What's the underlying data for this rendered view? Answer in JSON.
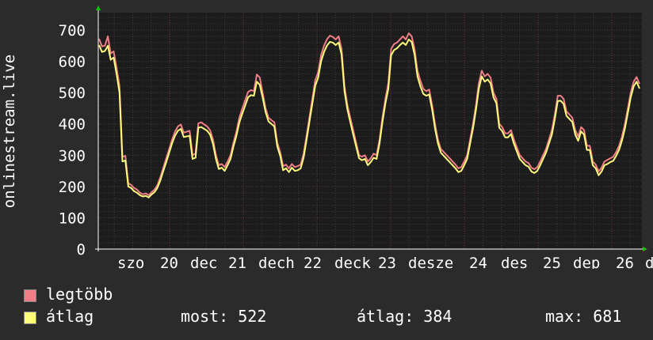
{
  "chart_data": {
    "type": "line",
    "ylabel": "onlinestream.live",
    "ylim": [
      0,
      700
    ],
    "yticks": [
      0,
      100,
      200,
      300,
      400,
      500,
      600,
      700
    ],
    "xticks": [
      "szo",
      "20",
      "dec",
      "21",
      "dech",
      "22",
      "deck",
      "23",
      "desze",
      "24",
      "des",
      "25",
      "dep",
      "26",
      "d"
    ],
    "grid": true,
    "series": [
      {
        "name": "legtöbb",
        "color": "#f07e86",
        "values": [
          672,
          648,
          650,
          680,
          625,
          632,
          580,
          520,
          295,
          298,
          210,
          205,
          195,
          190,
          180,
          175,
          178,
          172,
          182,
          190,
          205,
          230,
          260,
          290,
          320,
          350,
          375,
          392,
          398,
          372,
          375,
          378,
          300,
          305,
          402,
          405,
          398,
          392,
          380,
          350,
          300,
          268,
          272,
          262,
          280,
          300,
          340,
          375,
          420,
          448,
          475,
          502,
          508,
          505,
          558,
          548,
          500,
          450,
          420,
          412,
          405,
          340,
          310,
          265,
          270,
          258,
          272,
          262,
          265,
          270,
          305,
          360,
          420,
          480,
          540,
          565,
          620,
          650,
          670,
          682,
          678,
          670,
          680,
          640,
          520,
          460,
          420,
          380,
          340,
          300,
          295,
          300,
          280,
          290,
          305,
          300,
          350,
          420,
          480,
          530,
          640,
          655,
          660,
          670,
          680,
          670,
          690,
          680,
          640,
          570,
          538,
          512,
          505,
          510,
          460,
          400,
          350,
          320,
          310,
          300,
          290,
          280,
          270,
          258,
          262,
          280,
          300,
          350,
          400,
          460,
          530,
          570,
          552,
          560,
          548,
          500,
          480,
          400,
          390,
          370,
          370,
          380,
          350,
          325,
          300,
          290,
          280,
          275,
          260,
          255,
          262,
          280,
          300,
          320,
          350,
          380,
          430,
          490,
          490,
          480,
          440,
          430,
          420,
          380,
          360,
          390,
          380,
          330,
          330,
          280,
          270,
          248,
          260,
          280,
          285,
          290,
          295,
          310,
          330,
          360,
          400,
          450,
          500,
          535,
          550,
          528
        ]
      },
      {
        "name": "átlag",
        "color": "#fffb7c",
        "values": [
          652,
          630,
          633,
          650,
          605,
          612,
          560,
          500,
          280,
          283,
          200,
          195,
          185,
          180,
          172,
          168,
          170,
          165,
          175,
          182,
          196,
          220,
          250,
          278,
          308,
          338,
          362,
          378,
          384,
          358,
          360,
          362,
          288,
          292,
          388,
          390,
          384,
          378,
          366,
          336,
          288,
          256,
          260,
          250,
          268,
          288,
          328,
          362,
          404,
          432,
          458,
          485,
          492,
          490,
          535,
          525,
          485,
          438,
          408,
          400,
          392,
          328,
          298,
          252,
          258,
          246,
          260,
          250,
          252,
          258,
          292,
          347,
          406,
          464,
          522,
          548,
          600,
          630,
          650,
          662,
          660,
          652,
          660,
          622,
          505,
          446,
          406,
          366,
          328,
          290,
          284,
          288,
          268,
          278,
          292,
          288,
          337,
          406,
          465,
          512,
          620,
          636,
          642,
          652,
          660,
          652,
          670,
          662,
          622,
          552,
          520,
          496,
          490,
          494,
          446,
          386,
          338,
          308,
          298,
          288,
          278,
          268,
          258,
          246,
          250,
          268,
          288,
          337,
          386,
          445,
          512,
          552,
          535,
          542,
          530,
          485,
          466,
          388,
          377,
          357,
          357,
          368,
          337,
          312,
          288,
          278,
          268,
          263,
          248,
          243,
          250,
          268,
          288,
          308,
          337,
          366,
          416,
          473,
          474,
          464,
          426,
          416,
          406,
          366,
          346,
          376,
          366,
          317,
          317,
          268,
          258,
          236,
          248,
          268,
          272,
          278,
          282,
          298,
          317,
          347,
          386,
          436,
          485,
          520,
          535,
          513
        ]
      }
    ]
  },
  "legend": {
    "items": [
      {
        "label": "legtöbb",
        "color": "#f07e86"
      },
      {
        "label": "átlag",
        "color": "#fffb7c"
      }
    ],
    "stats": {
      "most": "most: 522",
      "atlag": "átlag: 384",
      "max": "max: 681"
    }
  }
}
